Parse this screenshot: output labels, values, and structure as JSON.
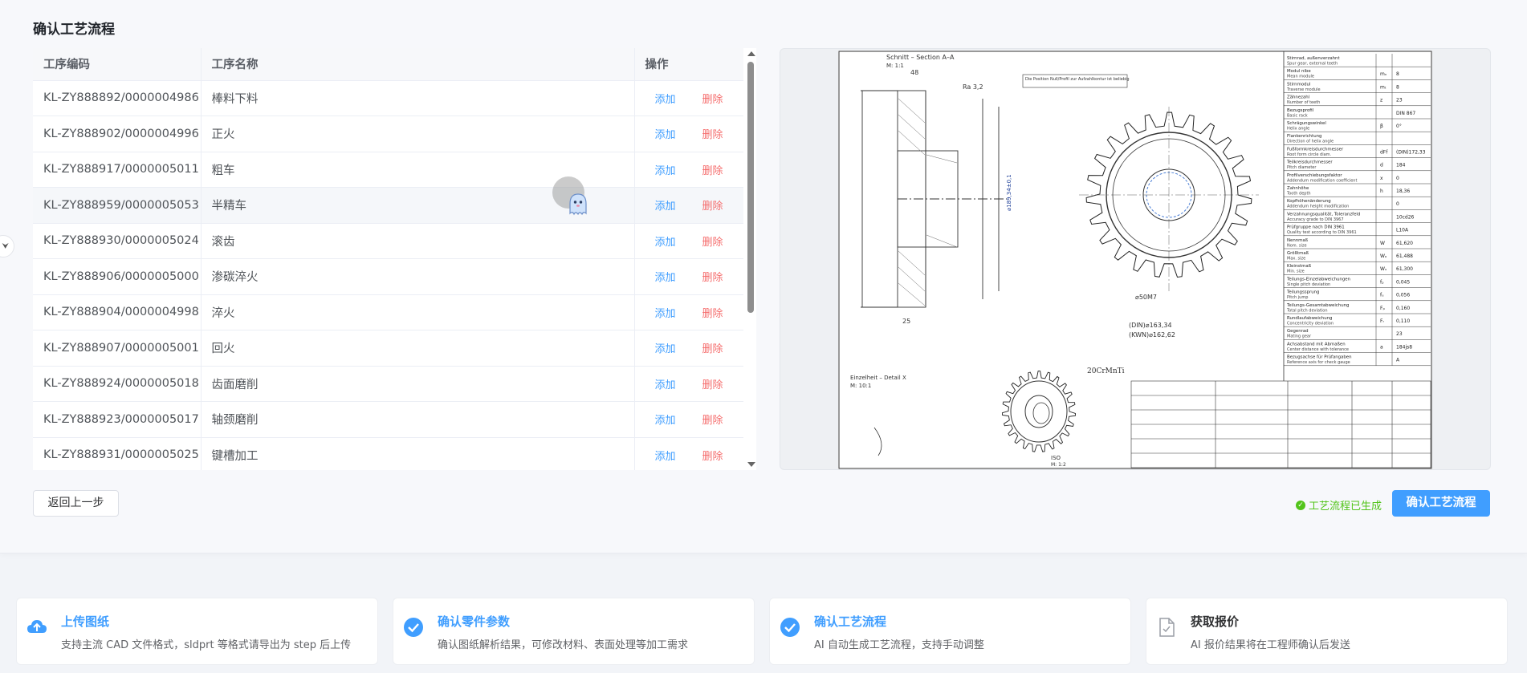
{
  "page": {
    "title": "确认工艺流程"
  },
  "table": {
    "headers": {
      "code": "工序编码",
      "name": "工序名称",
      "op": "操作"
    },
    "add_label": "添加",
    "delete_label": "删除",
    "rows": [
      {
        "code": "KL-ZY888892/0000004986",
        "name": "棒料下料"
      },
      {
        "code": "KL-ZY888902/0000004996",
        "name": "正火"
      },
      {
        "code": "KL-ZY888917/0000005011",
        "name": "粗车"
      },
      {
        "code": "KL-ZY888959/0000005053",
        "name": "半精车"
      },
      {
        "code": "KL-ZY888930/0000005024",
        "name": "滚齿"
      },
      {
        "code": "KL-ZY888906/0000005000",
        "name": "渗碳淬火"
      },
      {
        "code": "KL-ZY888904/0000004998",
        "name": "淬火"
      },
      {
        "code": "KL-ZY888907/0000005001",
        "name": "回火"
      },
      {
        "code": "KL-ZY888924/0000005018",
        "name": "齿面磨削"
      },
      {
        "code": "KL-ZY888923/0000005017",
        "name": "轴颈磨削"
      },
      {
        "code": "KL-ZY888931/0000005025",
        "name": "键槽加工"
      }
    ]
  },
  "drawing": {
    "section_label": "Schnitt – Section A–A",
    "scale_label": "M: 1:1",
    "material": "20CrMnTi",
    "pitch_dia": "(DIN)⌀163,34",
    "root_dia": "(KWN)⌀162,62",
    "bore": "⌀50M7",
    "outer_dia": "⌀189,34±0,1",
    "detail_label": "Einzelheit – Detail X",
    "detail_scale": "M: 10:1",
    "iso_label": "ISO",
    "iso_scale": "M: 1:2",
    "spec_rows": [
      {
        "label": "Stirnrad, außenverzahnt",
        "sub": "Spur gear, external teeth",
        "sym": "",
        "val": ""
      },
      {
        "label": "Modul nibe",
        "sub": "Mean module",
        "sym": "mₙ",
        "val": "8"
      },
      {
        "label": "Stirnmodul",
        "sub": "Traverse module",
        "sym": "mₜ",
        "val": "8"
      },
      {
        "label": "Zähnezahl",
        "sub": "Number of teeth",
        "sym": "z",
        "val": "23"
      },
      {
        "label": "Bezugsprofil",
        "sub": "Basic rack",
        "sym": "",
        "val": "DIN 867"
      },
      {
        "label": "Schrägungswinkel",
        "sub": "Helix angle",
        "sym": "β",
        "val": "0°"
      },
      {
        "label": "Flankenrichtung",
        "sub": "Direction of helix angle",
        "sym": "",
        "val": ""
      },
      {
        "label": "Fußformkreisdurchmesser",
        "sub": "Root form circle diam.",
        "sym": "dFf",
        "val": "(DIN)172,33"
      },
      {
        "label": "Teilkreisdurchmesser",
        "sub": "Pitch diameter",
        "sym": "d",
        "val": "184"
      },
      {
        "label": "Profilverschiebungsfaktor",
        "sub": "Addendum modification coefficient",
        "sym": "x",
        "val": "0"
      },
      {
        "label": "Zahnhöhe",
        "sub": "Tooth depth",
        "sym": "h",
        "val": "18,36"
      },
      {
        "label": "Kopfhöhenänderung",
        "sub": "Addendum height modification",
        "sym": "",
        "val": "0"
      },
      {
        "label": "Verzahnungsqualität, Toleranzfeld",
        "sub": "Accuracy grade to DIN 3967",
        "sym": "",
        "val": "10cd26"
      },
      {
        "label": "Prüfgruppe nach DIN 3961",
        "sub": "Quality test according to DIN 3961",
        "sym": "",
        "val": "L10A"
      },
      {
        "label": "Nennmaß",
        "sub": "Nom. size",
        "sym": "W",
        "val": "61,620"
      },
      {
        "label": "Größtmaß",
        "sub": "Max. size",
        "sym": "Wₒ",
        "val": "61,488"
      },
      {
        "label": "Kleinstmaß",
        "sub": "Min. size",
        "sym": "Wᵤ",
        "val": "61,300"
      },
      {
        "label": "Teilungs-Einzelabweichungen",
        "sub": "Single pitch deviation",
        "sym": "fₚ",
        "val": "0,045"
      },
      {
        "label": "Teilungssprung",
        "sub": "Pitch jump",
        "sym": "fᵤ",
        "val": "0,056"
      },
      {
        "label": "Teilungs-Gesamtabweichung",
        "sub": "Total pitch deviation",
        "sym": "Fₚ",
        "val": "0,160"
      },
      {
        "label": "Rundlaufabweichung",
        "sub": "Concentricity deviation",
        "sym": "Fᵣ",
        "val": "0,110"
      },
      {
        "label": "Gegenrad",
        "sub": "Mating gear",
        "sym": "",
        "val": "23"
      },
      {
        "label": "Achsabstand mit Abmaßen",
        "sub": "Center distance with tolerance",
        "sym": "a",
        "val": "184js8"
      },
      {
        "label": "Bezugsachse für Prüfangaben",
        "sub": "Reference axis for check gauge",
        "sym": "",
        "val": "A"
      }
    ]
  },
  "actions": {
    "back_label": "返回上一步",
    "status_text": "工艺流程已生成",
    "confirm_label": "确认工艺流程"
  },
  "steps": [
    {
      "title": "上传图纸",
      "desc": "支持主流 CAD 文件格式，sldprt 等格式请导出为 step 后上传",
      "state": "done",
      "icon": "cloud-upload-icon"
    },
    {
      "title": "确认零件参数",
      "desc": "确认图纸解析结果，可修改材料、表面处理等加工需求",
      "state": "done",
      "icon": "check-circle-icon"
    },
    {
      "title": "确认工艺流程",
      "desc": "AI 自动生成工艺流程，支持手动调整",
      "state": "active",
      "icon": "check-circle-icon"
    },
    {
      "title": "获取报价",
      "desc": "AI 报价结果将在工程师确认后发送",
      "state": "pending",
      "icon": "document-icon"
    }
  ],
  "colors": {
    "primary": "#409eff",
    "danger": "#f56c6c",
    "success": "#52c41a"
  }
}
